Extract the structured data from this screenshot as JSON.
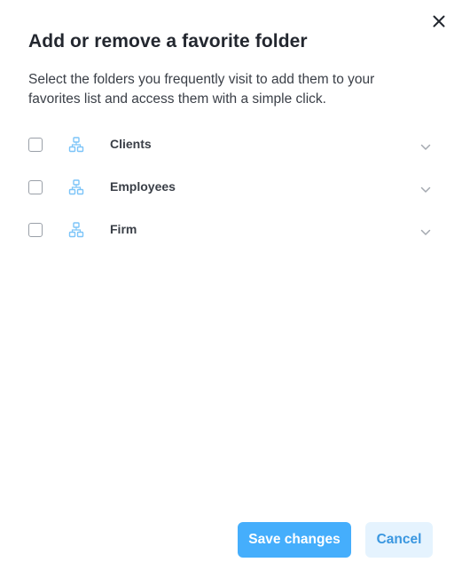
{
  "dialog": {
    "title": "Add or remove a favorite folder",
    "description": "Select the folders you frequently visit to add them to your favorites list and access them with a simple click.",
    "close_icon": "close-icon"
  },
  "folders": [
    {
      "label": "Clients",
      "checked": false,
      "icon": "folder-tree-icon",
      "expand_icon": "chevron-down-icon"
    },
    {
      "label": "Employees",
      "checked": false,
      "icon": "folder-tree-icon",
      "expand_icon": "chevron-down-icon"
    },
    {
      "label": "Firm",
      "checked": false,
      "icon": "folder-tree-icon",
      "expand_icon": "chevron-down-icon"
    }
  ],
  "actions": {
    "save_label": "Save changes",
    "cancel_label": "Cancel"
  },
  "colors": {
    "primary": "#45aefc",
    "secondary_bg": "#e5f3fe",
    "secondary_text": "#3a97e0",
    "icon": "#7cc4f8"
  }
}
